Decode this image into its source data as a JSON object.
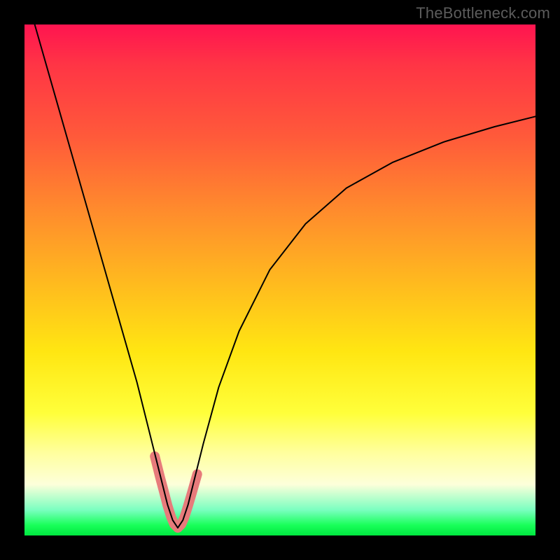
{
  "watermark": "TheBottleneck.com",
  "chart_data": {
    "type": "line",
    "title": "",
    "xlabel": "",
    "ylabel": "",
    "xlim": [
      0,
      100
    ],
    "ylim": [
      0,
      100
    ],
    "grid": false,
    "legend": false,
    "series": [
      {
        "name": "bottleneck-curve",
        "color": "#000000",
        "stroke_width": 2,
        "x": [
          2,
          6,
          10,
          14,
          18,
          22,
          24,
          26,
          27,
          28,
          29,
          30,
          31,
          32,
          33,
          35,
          38,
          42,
          48,
          55,
          63,
          72,
          82,
          92,
          100
        ],
        "y": [
          100,
          86,
          72,
          58,
          44,
          30,
          22,
          14,
          10,
          6,
          3,
          1.5,
          3,
          6,
          10,
          18,
          29,
          40,
          52,
          61,
          68,
          73,
          77,
          80,
          82
        ]
      },
      {
        "name": "highlight-band",
        "color": "#e77b7b",
        "stroke_width": 14,
        "x": [
          25.5,
          26.5,
          27.3,
          28.0,
          28.7,
          29.3,
          30.0,
          30.7,
          31.3,
          32.0,
          32.8,
          33.8
        ],
        "y": [
          15.5,
          11.5,
          8.5,
          5.8,
          3.6,
          2.2,
          1.5,
          2.2,
          3.6,
          5.8,
          8.5,
          12.0
        ]
      }
    ]
  },
  "colors": {
    "background_frame": "#000000",
    "gradient_top": "#ff1450",
    "gradient_mid": "#ffe612",
    "gradient_bottom": "#00e840",
    "curve": "#000000",
    "highlight": "#e77b7b",
    "watermark": "#5c5c5c"
  }
}
